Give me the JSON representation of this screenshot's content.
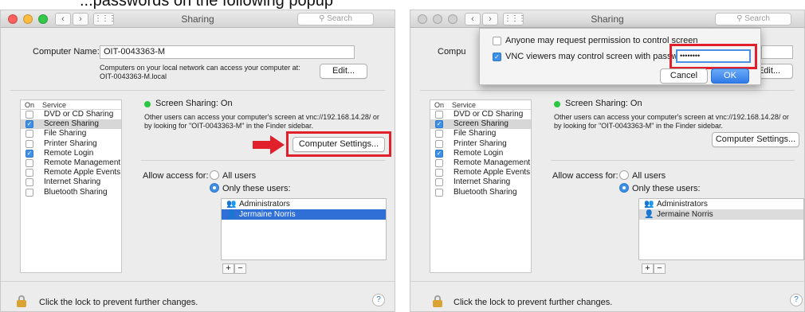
{
  "caption": "...passwords on the following popup",
  "colors": {
    "accent": "#3d8fe8",
    "highlight": "#e0202a",
    "status_on": "#28c940"
  },
  "window": {
    "title": "Sharing",
    "search_placeholder": "Search",
    "computer_name_label": "Computer Name:",
    "computer_name_value": "OIT-0043363-M",
    "network_note_line1": "Computers on your local network can access your computer at:",
    "network_note_line2": "OIT-0043363-M.local",
    "edit_button": "Edit...",
    "service_header_on": "On",
    "service_header_service": "Service",
    "services": [
      {
        "label": "DVD or CD Sharing",
        "checked": false,
        "selected": false
      },
      {
        "label": "Screen Sharing",
        "checked": true,
        "selected": true
      },
      {
        "label": "File Sharing",
        "checked": false,
        "selected": false
      },
      {
        "label": "Printer Sharing",
        "checked": false,
        "selected": false
      },
      {
        "label": "Remote Login",
        "checked": true,
        "selected": false
      },
      {
        "label": "Remote Management",
        "checked": false,
        "selected": false
      },
      {
        "label": "Remote Apple Events",
        "checked": false,
        "selected": false
      },
      {
        "label": "Internet Sharing",
        "checked": false,
        "selected": false
      },
      {
        "label": "Bluetooth Sharing",
        "checked": false,
        "selected": false
      }
    ],
    "status": "Screen Sharing: On",
    "status_desc_line1": "Other users can access your computer's screen at vnc://192.168.14.28/ or",
    "status_desc_line2": "by looking for \"OIT-0043363-M\" in the Finder sidebar.",
    "computer_settings_button": "Computer Settings...",
    "allow_access_label": "Allow access for:",
    "radio_all": "All users",
    "radio_only": "Only these users:",
    "users": [
      "Administrators",
      "Jermaine Norris"
    ],
    "plus": "+",
    "minus": "−",
    "lock_text": "Click the lock to prevent further changes.",
    "help": "?"
  },
  "sheet": {
    "option1": "Anyone may request permission to control screen",
    "option1_checked": false,
    "option2": "VNC viewers may control screen with password:",
    "option2_checked": true,
    "password_mask": "••••••••",
    "cancel": "Cancel",
    "ok": "OK"
  }
}
